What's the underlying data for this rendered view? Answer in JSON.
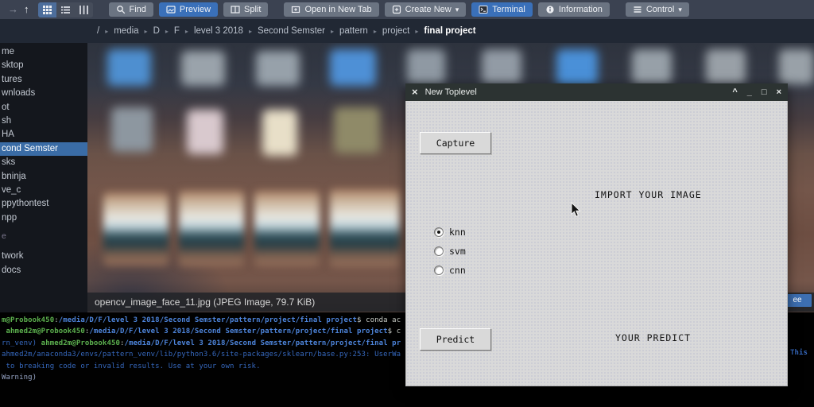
{
  "ui_colors": {
    "accent_blue": "#3a70b9",
    "selection_blue": "#3a6ca6",
    "dialog_bg": "#d9d9d9",
    "dialog_titlebar": "#2c3332"
  },
  "toolbar": {
    "find": "Find",
    "preview": "Preview",
    "split": "Split",
    "open_in_new_tab": "Open in New Tab",
    "create_new": "Create New",
    "terminal": "Terminal",
    "information": "Information",
    "control": "Control"
  },
  "breadcrumb": {
    "items": [
      "/",
      "media",
      "D",
      "F",
      "level 3 2018",
      "Second Semster",
      "pattern",
      "project",
      "final project"
    ]
  },
  "sidebar": {
    "items": [
      {
        "label": "me"
      },
      {
        "label": "sktop"
      },
      {
        "label": "tures"
      },
      {
        "label": "wnloads"
      },
      {
        "label": "ot"
      },
      {
        "label": "sh"
      },
      {
        "label": "HA"
      },
      {
        "label": "cond Semster",
        "active": true
      },
      {
        "label": "sks"
      },
      {
        "label": "bninja"
      },
      {
        "label": "ve_c"
      },
      {
        "label": "ppythontest"
      },
      {
        "label": "npp"
      },
      {
        "label": "e",
        "dim": true
      },
      {
        "label": "twork"
      },
      {
        "label": "docs"
      }
    ]
  },
  "statusbar": {
    "file_info": "opencv_image_face_11.jpg (JPEG Image, 79.7 KiB)",
    "tree_tab": "ee"
  },
  "dialog": {
    "title": "New Toplevel",
    "capture_button": "Capture",
    "import_label": "IMPORT YOUR IMAGE",
    "radios": [
      {
        "label": "knn",
        "selected": true
      },
      {
        "label": "svm",
        "selected": false
      },
      {
        "label": "cnn",
        "selected": false
      }
    ],
    "predict_button": "Predict",
    "predict_label": "YOUR PREDICT"
  },
  "terminal": {
    "colors": {
      "user": "#5cb04e",
      "path": "#4d84da",
      "plain": "#c9cdc7",
      "warn": "#3668bd",
      "dim": "#9aa8c9"
    },
    "lines": [
      [
        {
          "t": "m@Probook450",
          "c": "user"
        },
        {
          "t": ":",
          "c": "plain"
        },
        {
          "t": "/media/D/F/level 3 2018/Second Semster/pattern/project/final project",
          "c": "path"
        },
        {
          "t": "$ conda ac",
          "c": "plain"
        }
      ],
      [
        {
          "t": " ahmed2m@Probook450",
          "c": "user"
        },
        {
          "t": ":",
          "c": "plain"
        },
        {
          "t": "/media/D/F/level 3 2018/Second Semster/pattern/project/final project",
          "c": "path"
        },
        {
          "t": "$ c",
          "c": "plain"
        }
      ],
      [
        {
          "t": "rn_venv) ",
          "c": "warn"
        },
        {
          "t": "ahmed2m@Probook450",
          "c": "user"
        },
        {
          "t": ":",
          "c": "plain"
        },
        {
          "t": "/media/D/F/level 3 2018/Second Semster/pattern/project/final pr",
          "c": "path"
        }
      ],
      [
        {
          "t": "ahmed2m/anaconda3/envs/pattern_venv/lib/python3.6/site-packages/sklearn/base.py:253: UserWa",
          "c": "warn"
        }
      ],
      [
        {
          "t": " to breaking code or invalid results. Use at your own risk.",
          "c": "warn"
        }
      ],
      [
        {
          "t": "Warning)",
          "c": "dim"
        }
      ]
    ],
    "right_fragment": "This"
  }
}
